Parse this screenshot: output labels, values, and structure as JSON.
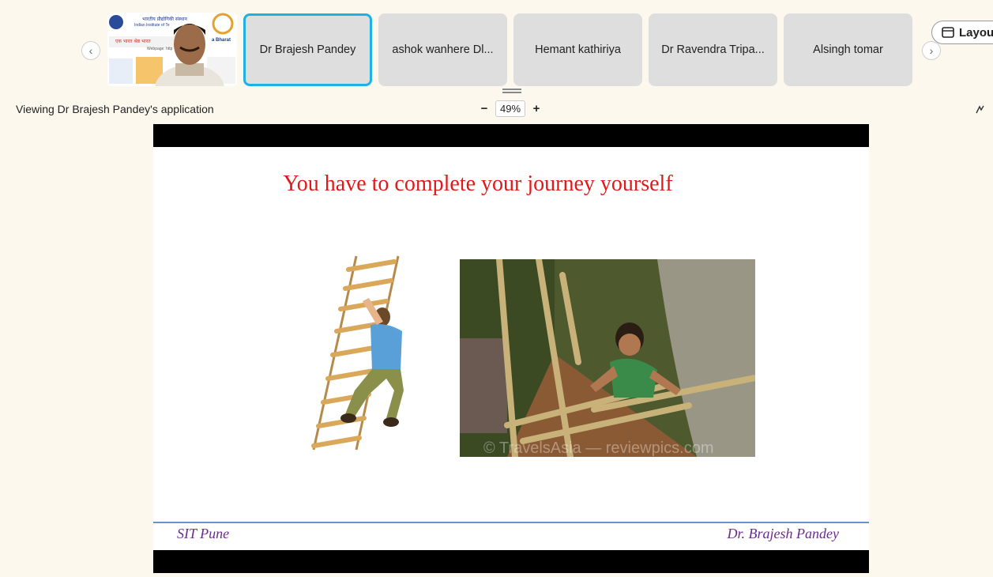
{
  "participants": {
    "tiles": [
      {
        "label": "Dr Brajesh Pandey",
        "active": true
      },
      {
        "label": "ashok wanhere Dl..."
      },
      {
        "label": "Hemant kathiriya"
      },
      {
        "label": "Dr Ravendra Tripa..."
      },
      {
        "label": "Alsingh tomar"
      }
    ],
    "video_logo_text": "भारतीय प्रौद्योगिकी संस्थान",
    "video_logo_sub": "Indian Institute of Te",
    "video_banner": "एक भारत श्रेष्ठ भारत",
    "video_banner_right": "a Bharat",
    "video_banner_sub": "Webpage: http"
  },
  "layout_button": {
    "label": "Layou"
  },
  "viewing_label": "Viewing Dr Brajesh Pandey's application",
  "zoom": {
    "minus": "−",
    "value": "49%",
    "plus": "+"
  },
  "slide": {
    "title": "You have to complete your journey yourself",
    "footer_left": "SIT Pune",
    "footer_right": "Dr. Brajesh Pandey",
    "watermark": "© TravelsAsia — reviewpics.com"
  },
  "colors": {
    "accent": "#1fb1e6",
    "title": "#e01919",
    "footer": "#6a2c8f",
    "footer_line": "#6b8fcf"
  },
  "icons": {
    "prev": "chevron-left-icon",
    "next": "chevron-right-icon",
    "layout": "layout-icon",
    "annotate": "pen-icon"
  }
}
